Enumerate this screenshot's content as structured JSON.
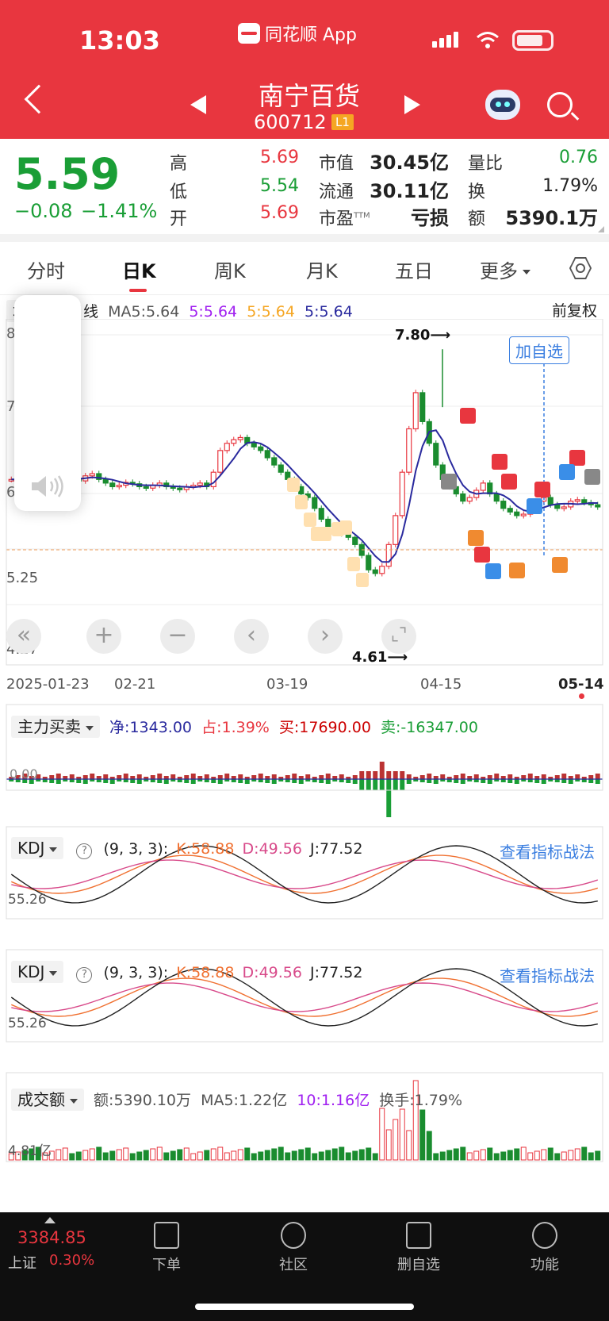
{
  "status_bar": {
    "time": "13:03",
    "app_name": "同花顺 App"
  },
  "header": {
    "stock_name": "南宁百货",
    "stock_code": "600712",
    "level_badge": "L1"
  },
  "quote": {
    "price": "5.59",
    "change": "−0.08",
    "change_pct": "−1.41%",
    "labels": {
      "high": "高",
      "low": "低",
      "open": "开",
      "mktcap": "市值",
      "float": "流通",
      "pe": "市盈",
      "volratio": "量比",
      "turnover": "换",
      "amount": "额"
    },
    "high": "5.69",
    "low": "5.54",
    "open": "5.69",
    "mktcap": "30.45亿",
    "float": "30.11亿",
    "pe_suffix": "TTM",
    "pe": "亏损",
    "volratio": "0.76",
    "turnover": "1.79%",
    "amount": "5390.1万"
  },
  "tabs": [
    "分时",
    "日K",
    "周K",
    "月K",
    "五日",
    "更多"
  ],
  "kline": {
    "select": "均线",
    "period": "日线",
    "ma_label": "MA5:5.64",
    "ma10": "5:5.64",
    "ma20": "5:5.64",
    "ma30": "5:5.64",
    "adjust": "前复权",
    "ymax_label": "8",
    "y7_label": "7",
    "y6_label": "6",
    "y525": "5.25",
    "ymin_label": "4.27",
    "high_label": "7.80⟶",
    "low_label": "4.61⟶",
    "add_watch": "加自选",
    "dates": [
      "2025-01-23",
      "02-21",
      "03-19",
      "04-15",
      "05-14"
    ],
    "numbers": [
      "1",
      "2",
      "3",
      "4",
      "5",
      "6",
      "7",
      "8",
      "9"
    ],
    "signals": [
      "B",
      "S",
      "T"
    ]
  },
  "capital": {
    "select": "主力买卖",
    "net": "净:1343.00",
    "ratio": "占:1.39%",
    "buy": "买:17690.00",
    "sell": "卖:-16347.00",
    "zero": "0.00"
  },
  "kdj1": {
    "select": "KDJ",
    "help": "?",
    "params": "(9, 3, 3):",
    "k": "K:58.88",
    "d": "D:49.56",
    "j": "J:77.52",
    "ylabel": "55.26",
    "link": "查看指标战法"
  },
  "kdj2": {
    "select": "KDJ",
    "help": "?",
    "params": "(9, 3, 3):",
    "k": "K:58.88",
    "d": "D:49.56",
    "j": "J:77.52",
    "ylabel": "55.26",
    "link": "查看指标战法"
  },
  "volume": {
    "select": "成交额",
    "amount": "额:5390.10万",
    "ma5": "MA5:1.22亿",
    "ma10": "10:1.16亿",
    "turnover": "换手:1.79%",
    "ylabel": "4.81亿"
  },
  "bottom": {
    "index_value": "3384.85",
    "index_name": "上证",
    "index_pct": "0.30%",
    "nav": [
      "下单",
      "社区",
      "删自选",
      "功能"
    ]
  },
  "colors": {
    "up": "#e8363f",
    "down": "#1a8c2f",
    "ma": "#2a2a9e",
    "k": "#f07030",
    "d": "#d84a8a",
    "j": "#222222"
  },
  "icons": [
    "back-icon",
    "prev-stock-icon",
    "next-stock-icon",
    "robot-icon",
    "search-icon",
    "settings-icon",
    "speaker-icon",
    "collapse-icon",
    "zoom-in-icon",
    "zoom-out-icon",
    "left-icon",
    "right-icon",
    "fullscreen-icon",
    "order-icon",
    "community-icon",
    "watchlist-icon",
    "menu-icon"
  ]
}
